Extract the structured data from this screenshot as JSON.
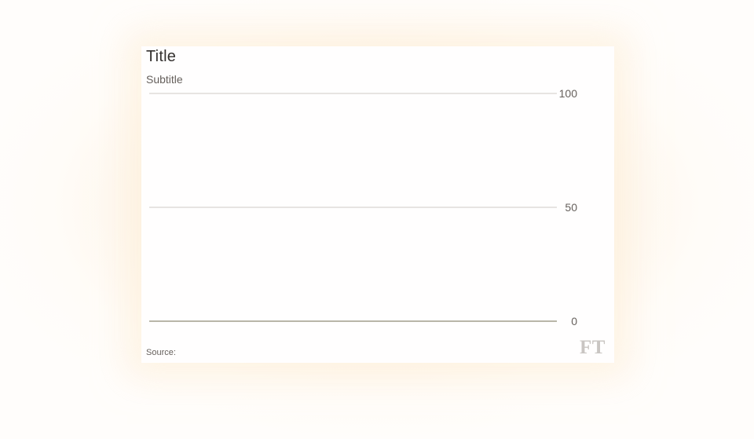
{
  "chart": {
    "title": "Title",
    "subtitle": "Subtitle",
    "source": "Source:",
    "logo": "FT"
  },
  "chart_data": {
    "type": "line",
    "title": "Title",
    "subtitle": "Subtitle",
    "source": "Source:",
    "xlabel": "",
    "ylabel": "",
    "ylim": [
      0,
      100
    ],
    "y_ticks": [
      0,
      50,
      100
    ],
    "y_tick_labels": [
      "0",
      "50",
      "100"
    ],
    "y_axis_side": "right",
    "grid": true,
    "series": [],
    "colors": {
      "gridline": "#cfcbc7",
      "baseline": "#b9b6a8",
      "text": "#66605c",
      "logo": "#c9c5c2"
    }
  }
}
